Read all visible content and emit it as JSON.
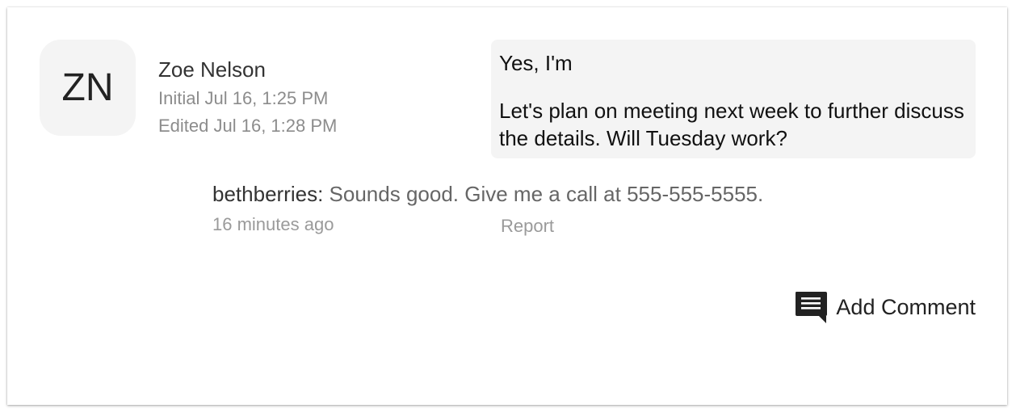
{
  "author": {
    "initials": "ZN",
    "name": "Zoe Nelson",
    "initial_time": "Initial Jul 16, 1:25 PM",
    "edited_time": "Edited Jul 16, 1:28 PM"
  },
  "message": {
    "line1": "Yes, I'm",
    "line2": "Let's plan on meeting next week to further discuss the details. Will Tuesday work?"
  },
  "reply": {
    "user": "bethberries:",
    "text": "Sounds good.  Give me a call at 555-555-5555.",
    "time": "16 minutes ago",
    "report_label": "Report"
  },
  "actions": {
    "add_comment_label": "Add Comment",
    "add_comment_icon": "comment-icon"
  },
  "colors": {
    "avatar_bg": "#f4f4f4",
    "bubble_bg": "#f4f4f4",
    "meta_text": "#8c8c8c",
    "icon": "#222222"
  }
}
